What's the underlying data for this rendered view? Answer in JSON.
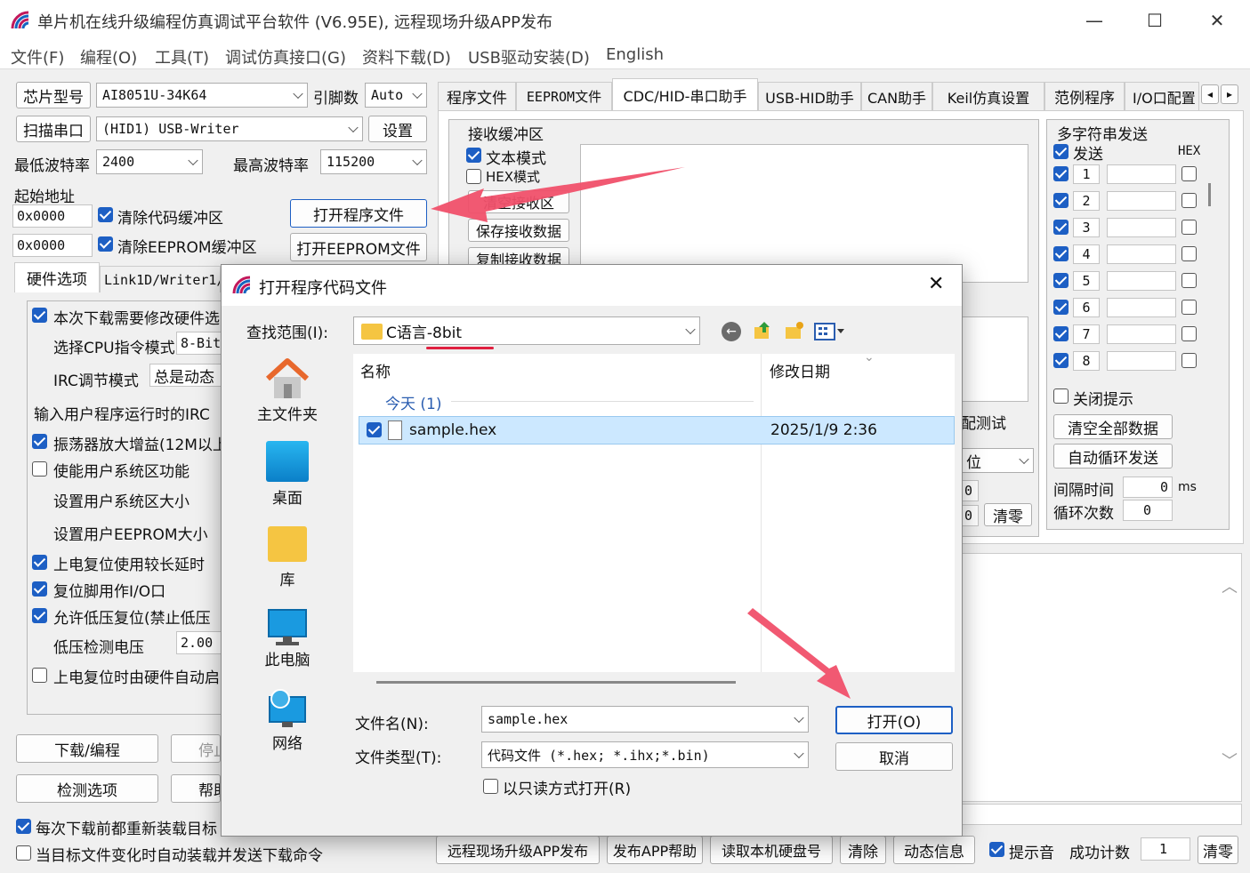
{
  "window": {
    "title": "单片机在线升级编程仿真调试平台软件 (V6.95E), 远程现场升级APP发布",
    "minimize": "—",
    "maximize": "☐",
    "close": "✕"
  },
  "menu": [
    "文件(F)",
    "编程(O)",
    "工具(T)",
    "调试仿真接口(G)",
    "资料下载(D)",
    "USB驱动安装(D)",
    "English"
  ],
  "left": {
    "chip_label": "芯片型号",
    "chip_value": "AI8051U-34K64",
    "pins_label": "引脚数",
    "pins_value": "Auto",
    "scan_label": "扫描串口",
    "port_value": "(HID1) USB-Writer",
    "settings_label": "设置",
    "min_baud_label": "最低波特率",
    "min_baud": "2400",
    "max_baud_label": "最高波特率",
    "max_baud": "115200",
    "start_addr_label": "起始地址",
    "addr1": "0x0000",
    "clear_code": "清除代码缓冲区",
    "open_prog": "打开程序文件",
    "addr2": "0x0000",
    "clear_eeprom": "清除EEPROM缓冲区",
    "open_eeprom": "打开EEPROM文件",
    "tab_hw": "硬件选项",
    "tab_link": "Link1D/Writer1/",
    "hw_items": [
      "本次下载需要修改硬件选",
      "选择CPU指令模式",
      "IRC调节模式",
      "输入用户程序运行时的IRC",
      "振荡器放大增益(12M以上",
      "使能用户系统区功能",
      "设置用户系统区大小",
      "设置用户EEPROM大小",
      "上电复位使用较长延时",
      "复位脚用作I/O口",
      "允许低压复位(禁止低压",
      "低压检测电压",
      "上电复位时由硬件自动启"
    ],
    "cpu_mode": "8-Bit",
    "irc_mode": "总是动态",
    "lvd_value": "2.00",
    "download_btn": "下载/编程",
    "stop_btn": "停止",
    "check_btn": "检测选项",
    "help_btn": "帮助",
    "reload_opt": "每次下载前都重新装载目标",
    "auto_opt": "当目标文件变化时自动装载并发送下载命令"
  },
  "tabs": [
    "程序文件",
    "EEPROM文件",
    "CDC/HID-串口助手",
    "USB-HID助手",
    "CAN助手",
    "Keil仿真设置",
    "范例程序",
    "I/O口配置"
  ],
  "tab_nav": [
    "◂",
    "▸"
  ],
  "serial": {
    "recv_group": "接收缓冲区",
    "text_mode": "文本模式",
    "hex_mode": "HEX模式",
    "clear_recv": "清空接收区",
    "save_recv": "保存接收数据",
    "copy_recv": "复制接收数据",
    "multi_group": "多字符串发送",
    "send_label": "发送",
    "hex_label": "HEX",
    "rows": [
      "1",
      "2",
      "3",
      "4",
      "5",
      "6",
      "7",
      "8"
    ],
    "close_tip": "关闭提示",
    "clear_all": "清空全部数据",
    "auto_loop": "自动循环发送",
    "interval_label": "间隔时间",
    "interval_value": "0",
    "interval_unit": "ms",
    "loop_label": "循环次数",
    "loop_value": "0",
    "match_test": "配测试",
    "bits": "位",
    "zero1": "0",
    "zero2": "0",
    "clear_zero": "清零"
  },
  "bottom": {
    "remote_app": "远程现场升级APP发布",
    "app_help": "发布APP帮助",
    "read_disk": "读取本机硬盘号",
    "clear": "清除",
    "dyn_info": "动态信息",
    "beep": "提示音",
    "success_label": "成功计数",
    "success_value": "1",
    "reset": "清零"
  },
  "dialog": {
    "title": "打开程序代码文件",
    "close": "✕",
    "lookin_label": "查找范围(I):",
    "folder": "C语言-8bit",
    "places": [
      "主文件夹",
      "桌面",
      "库",
      "此电脑",
      "网络"
    ],
    "col_name": "名称",
    "col_date": "修改日期",
    "group": "今天 (1)",
    "file_name": "sample.hex",
    "file_date": "2025/1/9 2:36",
    "filename_label": "文件名(N):",
    "filename_value": "sample.hex",
    "filetype_label": "文件类型(T):",
    "filetype_value": "代码文件 (*.hex; *.ihx;*.bin)",
    "readonly": "以只读方式打开(R)",
    "open_btn": "打开(O)",
    "cancel_btn": "取消"
  },
  "colors": {
    "accent": "#1d5fc4",
    "arrow": "#f0506a",
    "underline": "#e02040",
    "selection": "#cce8ff"
  }
}
